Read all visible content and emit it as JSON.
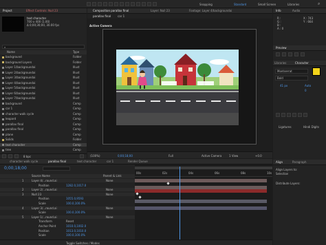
{
  "menu": {
    "items": [
      "Standard",
      "Small Screen",
      "Libraries"
    ]
  },
  "project": {
    "tab": "Project",
    "effect_tab": "Effect Controls: Null 23",
    "selected_name": "text character",
    "selected_meta": "700 x 400 (1.00)",
    "selected_meta2": "Δ 0;00;30;00, 30.00 fps",
    "search_placeholder": "⌕",
    "col_name": "Name",
    "col_type": "Type",
    "items": [
      {
        "name": "background",
        "type": "Folder",
        "folder": true
      },
      {
        "name": "background Layers",
        "type": "Folder",
        "folder": true
      },
      {
        "name": "Layer 1/backgroundai",
        "type": "Illust",
        "folder": false
      },
      {
        "name": "Layer 2/backgroundai",
        "type": "Illust",
        "folder": false
      },
      {
        "name": "Layer 3/backgroundai",
        "type": "Illust",
        "folder": false
      },
      {
        "name": "Layer 4/backgroundai",
        "type": "Illust",
        "folder": false
      },
      {
        "name": "Layer 5/backgroundai",
        "type": "Illust",
        "folder": false
      },
      {
        "name": "Layer 6/backgroundai",
        "type": "Illust",
        "folder": false
      },
      {
        "name": "Layer 7/backgroundai",
        "type": "Illust",
        "folder": false
      },
      {
        "name": "background",
        "type": "Comp",
        "folder": false
      },
      {
        "name": "car 1",
        "type": "Comp",
        "folder": false
      },
      {
        "name": "character walk cycle",
        "type": "Comp",
        "folder": false
      },
      {
        "name": "leopard",
        "type": "Comp",
        "folder": false
      },
      {
        "name": "parallax final",
        "type": "Comp",
        "folder": false
      },
      {
        "name": "parallax final",
        "type": "Comp",
        "folder": false
      },
      {
        "name": "plane",
        "type": "Comp",
        "folder": false
      },
      {
        "name": "Solids",
        "type": "Folder",
        "folder": true
      },
      {
        "name": "text character",
        "type": "Comp",
        "folder": false
      },
      {
        "name": "tree",
        "type": "Comp",
        "folder": false
      }
    ],
    "bpc": "8 bpc"
  },
  "composition": {
    "tab": "Composition parallax final",
    "layer_tab": "Layer: Null 23",
    "footage_tab": "Footage: Layer 4/backgroundai",
    "sub_tabs": [
      "parallax final",
      "car 1"
    ],
    "active_label": "Active Camera",
    "bottom_bar": [
      "(100%)",
      "0;00;18;00",
      "Full",
      "Active Camera",
      "1 View",
      "+0.0"
    ]
  },
  "toolbar_right": {
    "snapping": "Snapping",
    "workspace_label": "Standard"
  },
  "info": {
    "tab": "Info",
    "audio_tab": "Audio",
    "r": "R :",
    "g": "G :",
    "b": "B :",
    "a": "A : 0",
    "x": "X : 743",
    "y": "Y : 664",
    "preview_tab": "Preview",
    "libraries_tab": "Libraries",
    "character_tab": "Character",
    "font_name": "Montserrat",
    "font_style": "Bold",
    "font_size": "41 px",
    "leading": "Auto",
    "tracking": "0",
    "fill_color": "#f2d31a",
    "ligatures": "Ligatures",
    "hindi_digits": "Hindi Digits",
    "align_tab": "Align",
    "paragraph_tab": "Paragraph",
    "align_layers_to": "Align Layers to:",
    "selection": "Selection",
    "distribute_label": "Distribute Layers:"
  },
  "timeline": {
    "tabs": [
      "character walk cycle",
      "parallax final",
      "text character",
      "car 1",
      "Render Queue"
    ],
    "timecode": "0;00;18;00",
    "col_source": "Source Name",
    "col_parent": "Parent & Link",
    "ruler": [
      "00s",
      "02s",
      "04s",
      "06s",
      "08s",
      "10s"
    ],
    "layers": [
      {
        "num": "1",
        "name": "Layer 4/...round.ai",
        "parent": "None",
        "indent": false,
        "blue": false
      },
      {
        "num": "",
        "name": "Position",
        "parent": "1282.0,1017.0",
        "indent": true,
        "blue": true
      },
      {
        "num": "2",
        "name": "Layer 2/...round.ai",
        "parent": "None",
        "indent": false,
        "blue": false
      },
      {
        "num": "3",
        "name": "Null 23",
        "parent": "None",
        "indent": false,
        "blue": false
      },
      {
        "num": "",
        "name": "Position",
        "parent": "1055.0,9593",
        "indent": true,
        "blue": true
      },
      {
        "num": "",
        "name": "Scale",
        "parent": "100.0,100.0%",
        "indent": true,
        "blue": true
      },
      {
        "num": "4",
        "name": "Layer 3/...round.ai",
        "parent": "None",
        "indent": false,
        "blue": false
      },
      {
        "num": "",
        "name": "Scale",
        "parent": "100.0,100.0%",
        "indent": true,
        "blue": true
      },
      {
        "num": "5",
        "name": "Layer 1/...round.ai",
        "parent": "None",
        "indent": false,
        "blue": false
      },
      {
        "num": "",
        "name": "Transform",
        "parent": "Reset",
        "indent": true,
        "blue": false
      },
      {
        "num": "",
        "name": "Anchor Point",
        "parent": "1010.0,1002.0",
        "indent": true,
        "blue": true
      },
      {
        "num": "",
        "name": "Position",
        "parent": "1013.0,1010.0",
        "indent": true,
        "blue": true
      },
      {
        "num": "",
        "name": "Scale",
        "parent": "100.0,100.0%",
        "indent": true,
        "blue": true
      }
    ],
    "toggle_label": "Toggle Switches / Modes"
  }
}
